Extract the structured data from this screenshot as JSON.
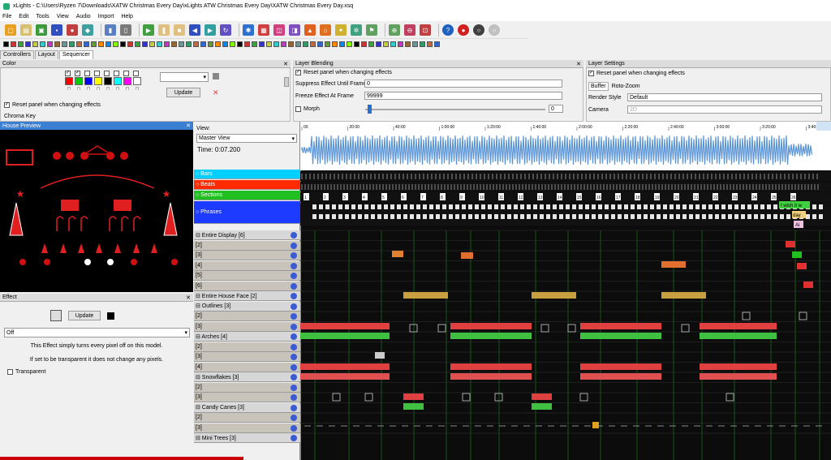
{
  "title": "xLights - C:\\Users\\Ryzen 7\\Downloads\\XATW Christmas Every Day\\xLights ATW Christmas Every Day\\XATW Christmas Every Day.xsq",
  "menu": [
    "File",
    "Edit",
    "Tools",
    "View",
    "Audio",
    "Import",
    "Help"
  ],
  "tabs": [
    "Controllers",
    "Layout",
    "Sequencer"
  ],
  "color_panel": {
    "title": "Color",
    "update_label": "Update",
    "reset_label": "Reset panel when changing effects",
    "chroma_label": "Chroma Key",
    "swatches": [
      "#ff0000",
      "#00cc00",
      "#0000ff",
      "#ffff00",
      "#000000",
      "#00ffff",
      "#ff00ff",
      "#ffffff"
    ]
  },
  "layer_blending": {
    "title": "Layer Blending",
    "reset_label": "Reset panel when changing effects",
    "suppress_label": "Suppress Effect Until Frame",
    "suppress_value": "0",
    "freeze_label": "Freeze Effect At Frame",
    "freeze_value": "99999",
    "morph_label": "Morph",
    "morph_value": "0"
  },
  "layer_settings": {
    "title": "Layer Settings",
    "reset_label": "Reset panel when changing effects",
    "buffer_tab": "Buffer",
    "roto_tab": "Roto-Zoom",
    "render_label": "Render Style",
    "render_value": "Default",
    "camera_label": "Camera",
    "camera_value": "2D"
  },
  "house_preview": {
    "title": "House Preview"
  },
  "effect_panel": {
    "title": "Effect",
    "update_label": "Update",
    "select_value": "Off",
    "desc1": "This Effect simply turns every pixel off on this model.",
    "desc2": "If set to be transparent it does not change any pixels.",
    "transparent_label": "Transparent"
  },
  "sequencer": {
    "view_label": "View:",
    "view_value": "Master View",
    "time_label": "Time: 0:07.200",
    "timing_rows": [
      {
        "label": "Bars",
        "color": "#00d0ff"
      },
      {
        "label": "Beats",
        "color": "#ff2a00"
      },
      {
        "label": "Sections",
        "color": "#20c020"
      },
      {
        "label": "Phrases",
        "color": "#1d3bff"
      }
    ],
    "model_rows": [
      "Entire Display [6]",
      "[2]",
      "[3]",
      "[4]",
      "[5]",
      "[6]",
      "Entire House Face [2]",
      "Outlines [3]",
      "[2]",
      "[3]",
      "Arches [4]",
      "[2]",
      "[3]",
      "[4]",
      "Snowflakes [3]",
      "[2]",
      "[3]",
      "Candy Canes [3]",
      "[2]",
      "[3]",
      "Mini Trees [3]"
    ],
    "ruler": [
      "00",
      "20:00",
      "40:00",
      "1:00:00",
      "1:20:00",
      "1:40:00",
      "2:00:00",
      "2:20:00",
      "2:40:00",
      "3:00:00",
      "3:20:00",
      "3:40:00"
    ],
    "section_numbers": [
      "1",
      "2",
      "3",
      "4",
      "5",
      "6",
      "7",
      "8",
      "9",
      "10",
      "11",
      "12",
      "13",
      "14",
      "15",
      "16",
      "17",
      "18",
      "19",
      "20",
      "21",
      "22",
      "23",
      "24",
      "25",
      "26"
    ],
    "lyric_labels": [
      "I wish it w",
      "day",
      "Ai"
    ]
  }
}
